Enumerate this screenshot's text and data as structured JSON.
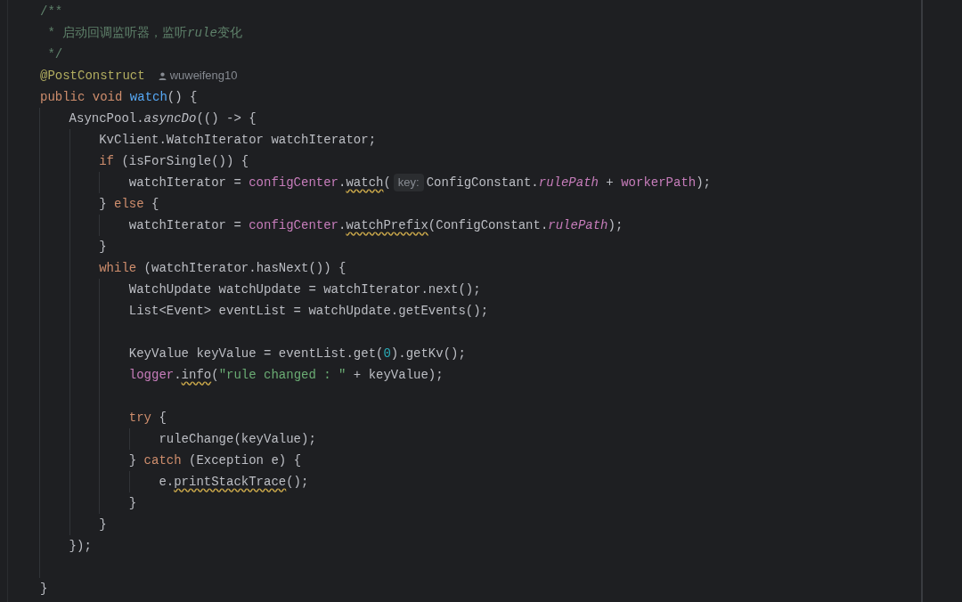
{
  "editor": {
    "lines": [
      {
        "parts": [
          {
            "kind": "doc",
            "text": "/**"
          }
        ]
      },
      {
        "parts": [
          {
            "kind": "doc",
            "text": " * 启动回调监听器，监听"
          },
          {
            "kind": "doc_italic",
            "text": "rule"
          },
          {
            "kind": "doc",
            "text": "变化"
          }
        ]
      },
      {
        "parts": [
          {
            "kind": "doc",
            "text": " */"
          }
        ]
      },
      {
        "parts": [
          {
            "kind": "annotation",
            "text": "@PostConstruct"
          },
          {
            "kind": "author",
            "text": "wuweifeng10"
          }
        ]
      },
      {
        "parts": [
          {
            "kind": "keyword",
            "text": "public void "
          },
          {
            "kind": "decl",
            "text": "watch"
          },
          {
            "kind": "plain",
            "text": "() {"
          }
        ]
      },
      {
        "parts": [
          {
            "kind": "plain",
            "text": "    AsyncPool."
          },
          {
            "kind": "static_method",
            "text": "asyncDo"
          },
          {
            "kind": "plain",
            "text": "(() -> {"
          }
        ]
      },
      {
        "parts": [
          {
            "kind": "plain",
            "text": "        KvClient.WatchIterator watchIterator;"
          }
        ]
      },
      {
        "parts": [
          {
            "kind": "keyword",
            "text": "        if"
          },
          {
            "kind": "plain",
            "text": " (isForSingle()) {"
          }
        ]
      },
      {
        "parts": [
          {
            "kind": "plain",
            "text": "            watchIterator = "
          },
          {
            "kind": "field",
            "text": "configCenter"
          },
          {
            "kind": "plain",
            "text": "."
          },
          {
            "kind": "method_warn",
            "text": "watch"
          },
          {
            "kind": "plain",
            "text": "("
          },
          {
            "kind": "hint",
            "text": "key:"
          },
          {
            "kind": "plain",
            "text": "ConfigConstant."
          },
          {
            "kind": "static_field",
            "text": "rulePath"
          },
          {
            "kind": "plain",
            "text": " + "
          },
          {
            "kind": "field",
            "text": "workerPath"
          },
          {
            "kind": "plain",
            "text": ");"
          }
        ]
      },
      {
        "parts": [
          {
            "kind": "plain",
            "text": "        } "
          },
          {
            "kind": "keyword",
            "text": "else"
          },
          {
            "kind": "plain",
            "text": " {"
          }
        ]
      },
      {
        "parts": [
          {
            "kind": "plain",
            "text": "            watchIterator = "
          },
          {
            "kind": "field",
            "text": "configCenter"
          },
          {
            "kind": "plain",
            "text": "."
          },
          {
            "kind": "method_warn",
            "text": "watchPrefix"
          },
          {
            "kind": "plain",
            "text": "(ConfigConstant."
          },
          {
            "kind": "static_field",
            "text": "rulePath"
          },
          {
            "kind": "plain",
            "text": ");"
          }
        ]
      },
      {
        "parts": [
          {
            "kind": "plain",
            "text": "        }"
          }
        ]
      },
      {
        "parts": [
          {
            "kind": "keyword",
            "text": "        while"
          },
          {
            "kind": "plain",
            "text": " (watchIterator.hasNext()) {"
          }
        ]
      },
      {
        "parts": [
          {
            "kind": "plain",
            "text": "            WatchUpdate watchUpdate = watchIterator.next();"
          }
        ]
      },
      {
        "parts": [
          {
            "kind": "plain",
            "text": "            List<Event> eventList = watchUpdate.getEvents();"
          }
        ]
      },
      {
        "kind": "blank"
      },
      {
        "parts": [
          {
            "kind": "plain",
            "text": "            KeyValue keyValue = eventList.get("
          },
          {
            "kind": "number",
            "text": "0"
          },
          {
            "kind": "plain",
            "text": ").getKv();"
          }
        ]
      },
      {
        "parts": [
          {
            "kind": "field",
            "text": "            logger"
          },
          {
            "kind": "plain",
            "text": "."
          },
          {
            "kind": "method_warn",
            "text": "info"
          },
          {
            "kind": "plain",
            "text": "("
          },
          {
            "kind": "string",
            "text": "\"rule changed : \""
          },
          {
            "kind": "plain",
            "text": " + keyValue);"
          }
        ]
      },
      {
        "kind": "blank"
      },
      {
        "parts": [
          {
            "kind": "keyword",
            "text": "            try"
          },
          {
            "kind": "plain",
            "text": " {"
          }
        ]
      },
      {
        "parts": [
          {
            "kind": "plain",
            "text": "                ruleChange(keyValue);"
          }
        ]
      },
      {
        "parts": [
          {
            "kind": "plain",
            "text": "            } "
          },
          {
            "kind": "keyword",
            "text": "catch"
          },
          {
            "kind": "plain",
            "text": " (Exception e) {"
          }
        ]
      },
      {
        "parts": [
          {
            "kind": "plain",
            "text": "                e."
          },
          {
            "kind": "method_warn",
            "text": "printStackTrace"
          },
          {
            "kind": "plain",
            "text": "();"
          }
        ]
      },
      {
        "parts": [
          {
            "kind": "plain",
            "text": "            }"
          }
        ]
      },
      {
        "parts": [
          {
            "kind": "plain",
            "text": "        }"
          }
        ]
      },
      {
        "parts": [
          {
            "kind": "plain",
            "text": "    });"
          }
        ]
      },
      {
        "kind": "blank"
      },
      {
        "parts": [
          {
            "kind": "plain",
            "text": "}"
          }
        ]
      }
    ]
  }
}
